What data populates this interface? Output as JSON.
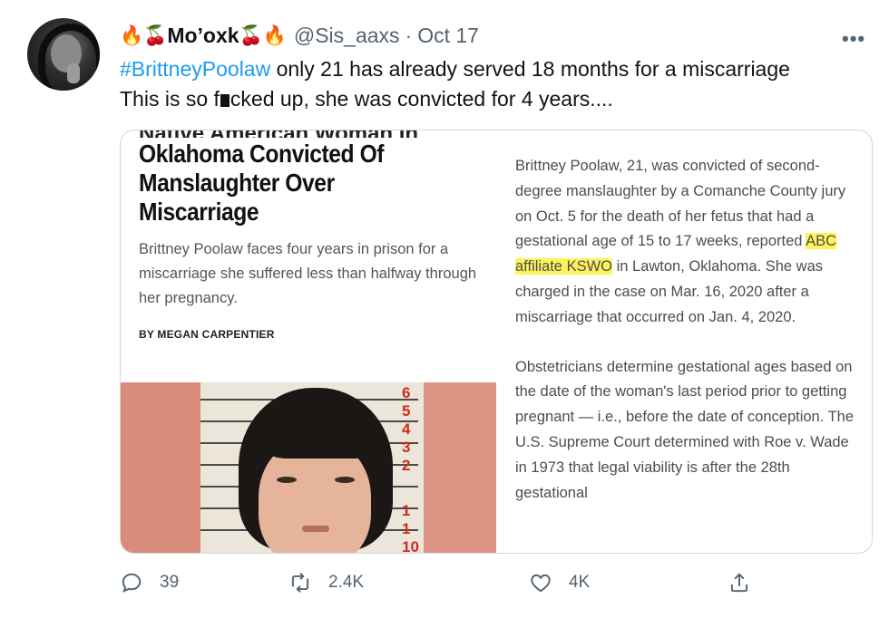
{
  "author": {
    "display_name": "Mo’oxk",
    "handle": "@Sis_aaxs",
    "separator": "·",
    "date": "Oct 17",
    "avatar_icon": "profile-avatar"
  },
  "more_menu_label": "•••",
  "tweet_text": {
    "hashtag": "#BrittneyPoolaw",
    "line1_rest": " only 21 has already served 18 months for a miscarriage",
    "line2_before": "This is so f",
    "line2_after": "cked up, she was convicted for 4 years...."
  },
  "article": {
    "cut_heading": "Native American Woman In",
    "headline": "Oklahoma Convicted Of Manslaughter Over Miscarriage",
    "subhead": "Brittney Poolaw faces four years in prison for a miscarriage she suffered less than halfway through her pregnancy.",
    "byline": "BY MEGAN CARPENTIER",
    "para1_before": "Brittney Poolaw, 21, was convicted of second-degree manslaughter by a Comanche County jury on Oct. 5 for the death of her fetus that had a gestational age of 15 to 17 weeks, reported ",
    "para1_highlight": "ABC affiliate KSWO",
    "para1_after": " in Lawton, Oklahoma. She was charged in the case on Mar. 16, 2020 after a miscarriage that occurred on Jan. 4, 2020.",
    "para2": "Obstetricians determine gestational ages based on the date of the woman's last period prior to getting pregnant — i.e., before the date of conception. The U.S. Supreme Court determined with Roe v. Wade in 1973 that legal viability is after the 28th gestational",
    "mugshot_numbers": [
      "6",
      "5",
      "4",
      "3",
      "2",
      "1",
      "1",
      "10"
    ]
  },
  "actions": {
    "reply": {
      "icon": "reply-icon",
      "count": "39"
    },
    "retweet": {
      "icon": "retweet-icon",
      "count": "2.4K"
    },
    "like": {
      "icon": "heart-icon",
      "count": "4K"
    },
    "share": {
      "icon": "share-icon"
    }
  },
  "colors": {
    "link": "#1d9bf0",
    "muted": "#536471",
    "highlight": "#fff35c"
  }
}
